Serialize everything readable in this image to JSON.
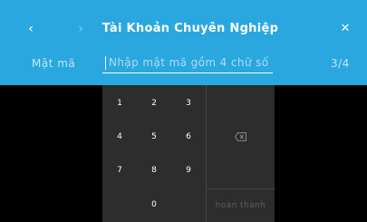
{
  "header": {
    "title": "Tài Khoản Chuyên Nghiệp",
    "back_icon": "chevron-left-icon",
    "forward_icon": "chevron-right-icon",
    "close_icon": "close-icon",
    "background": "#2aa7df"
  },
  "password_field": {
    "label": "Mật mã",
    "value": "",
    "placeholder": "Nhập mật mã gồm 4 chữ số ...",
    "progress": "3/4"
  },
  "keypad": {
    "keys": [
      "1",
      "2",
      "3",
      "4",
      "5",
      "6",
      "7",
      "8",
      "9",
      "0"
    ],
    "backspace_icon": "backspace-icon",
    "done_label": "hoàn thành",
    "background": "#2d2d2d"
  }
}
